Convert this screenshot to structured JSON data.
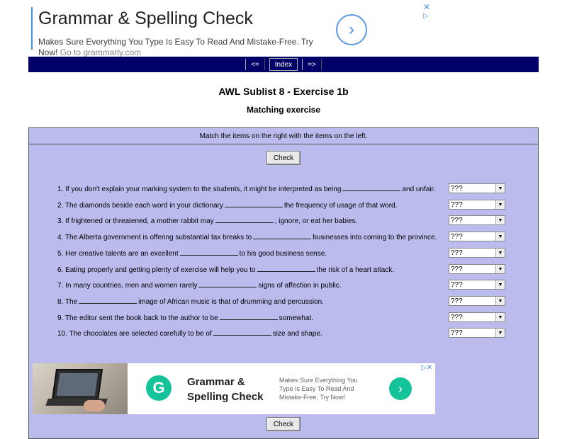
{
  "ad_top": {
    "title": "Grammar & Spelling Check",
    "description": "Makes Sure Everything You Type Is Easy To Read And Mistake-Free. Try Now!",
    "url": "Go to grammarly.com",
    "arrow_icon": "chevron-right-icon",
    "close_icon": "close-icon"
  },
  "nav": {
    "prev": "<=",
    "index": "Index",
    "next": "=>"
  },
  "page": {
    "title": "AWL Sublist 8 - Exercise 1b",
    "subtitle": "Matching exercise",
    "instructions": "Match the items on the right with the items on the left.",
    "check_label": "Check"
  },
  "questions": [
    {
      "before": "1. If you don't explain your marking system to the students, it might be interpreted as being",
      "after": "and unfair.",
      "answer": "???"
    },
    {
      "before": "2. The diamonds beside each word in your dictionary",
      "after": "the frequency of usage of that word.",
      "answer": "???"
    },
    {
      "before": "3. If frightened or threatened, a mother rabbit may",
      "after": ", ignore, or eat her babies.",
      "answer": "???"
    },
    {
      "before": "4. The Alberta government is offering substantial tax breaks to",
      "after": "businesses into coming to the province.",
      "answer": "???"
    },
    {
      "before": "5. Her creative talents are an excellent",
      "after": "to his good business sense.",
      "answer": "???"
    },
    {
      "before": "6. Eating properly and getting plenty of exercise will help you to",
      "after": "the risk of a heart attack.",
      "answer": "???"
    },
    {
      "before": "7. In many countries, men and women rarely",
      "after": "signs of affection in public.",
      "answer": "???"
    },
    {
      "before": "8. The",
      "after": "image of African music is that of drumming and percussion.",
      "answer": "???"
    },
    {
      "before": "9. The editor sent the book back to the author to be",
      "after": "somewhat.",
      "answer": "???"
    },
    {
      "before": "10. The chocolates are selected carefully to be of",
      "after": "size and shape.",
      "answer": "???"
    }
  ],
  "ad_bottom": {
    "title": "Grammar & Spelling Check",
    "description": "Makes Sure Everything You Type Is Easy To Read And Mistake-Free. Try Now!",
    "logo_letter": "G",
    "arrow_icon": "chevron-right-icon"
  },
  "colors": {
    "nav_bg": "#000066",
    "exercise_bg": "#bbbbee",
    "ad_accent": "#15c39a"
  }
}
